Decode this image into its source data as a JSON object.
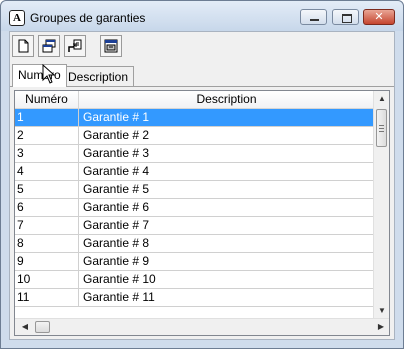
{
  "window": {
    "title": "Groupes de garanties",
    "app_icon_glyph": "A",
    "close_glyph": "✕"
  },
  "toolbar": {
    "buttons": [
      {
        "icon": "new-document-icon"
      },
      {
        "icon": "copy-windows-icon"
      },
      {
        "icon": "export-icon"
      },
      {
        "icon": "properties-icon"
      }
    ]
  },
  "tabs": [
    {
      "label": "Numéro",
      "active": true
    },
    {
      "label": "Description",
      "active": false
    }
  ],
  "grid": {
    "columns": [
      "Numéro",
      "Description"
    ],
    "rows": [
      {
        "num": "1",
        "desc": "Garantie # 1",
        "selected": true
      },
      {
        "num": "2",
        "desc": "Garantie # 2"
      },
      {
        "num": "3",
        "desc": "Garantie # 3"
      },
      {
        "num": "4",
        "desc": "Garantie # 4"
      },
      {
        "num": "5",
        "desc": "Garantie # 5"
      },
      {
        "num": "6",
        "desc": "Garantie # 6"
      },
      {
        "num": "7",
        "desc": "Garantie # 7"
      },
      {
        "num": "8",
        "desc": "Garantie # 8"
      },
      {
        "num": "9",
        "desc": "Garantie # 9"
      },
      {
        "num": "10",
        "desc": "Garantie # 10"
      },
      {
        "num": "11",
        "desc": "Garantie # 11"
      }
    ],
    "selection_color": "#3399ff"
  },
  "colors": {
    "titlebar": "#c7d7ea",
    "close_button": "#c5452f"
  }
}
